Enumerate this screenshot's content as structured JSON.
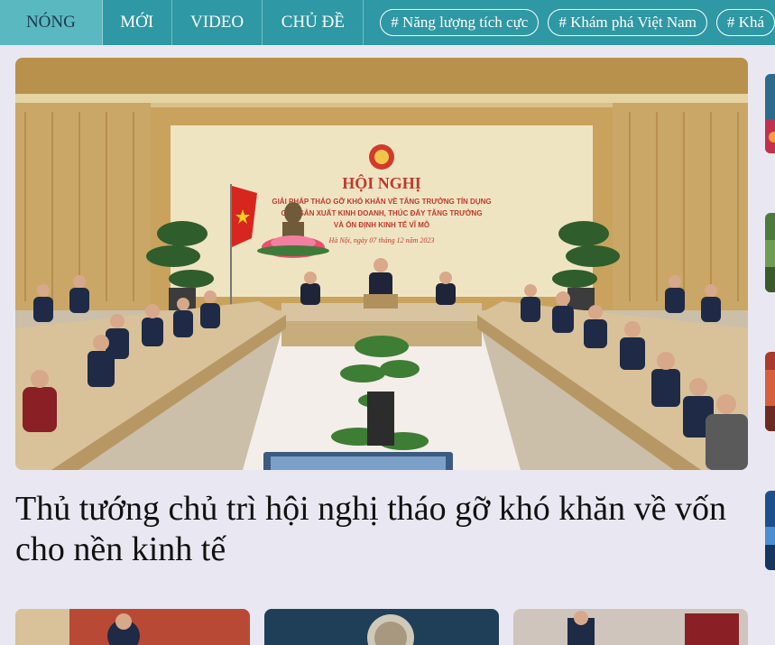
{
  "nav": {
    "tabs": [
      {
        "label": "NÓNG",
        "active": true
      },
      {
        "label": "MỚI",
        "active": false
      },
      {
        "label": "VIDEO",
        "active": false
      },
      {
        "label": "CHỦ ĐỀ",
        "active": false
      }
    ],
    "tags": [
      "# Năng lượng tích cực",
      "# Khám phá Việt Nam",
      "# Khá"
    ]
  },
  "hero": {
    "title": "Thủ tướng chủ trì hội nghị tháo gỡ khó khăn về vốn cho nền kinh tế",
    "banner": {
      "heading": "HỘI NGHỊ",
      "line1": "GIẢI PHÁP THÁO GỠ KHÓ KHĂN VỀ TĂNG TRƯỞNG TÍN DỤNG",
      "line2": "CHO SẢN XUẤT KINH DOANH, THÚC ĐẨY TĂNG TRƯỞNG",
      "line3": "VÀ ỔN ĐỊNH KINH TẾ VĨ MÔ",
      "date": "Hà Nội, ngày 07 tháng 12 năm 2023"
    }
  },
  "colors": {
    "nav_bg": "#2e98a4",
    "nav_active": "#5ab8c1",
    "page_bg": "#e9e7f1",
    "banner_text": "#c0392b"
  }
}
